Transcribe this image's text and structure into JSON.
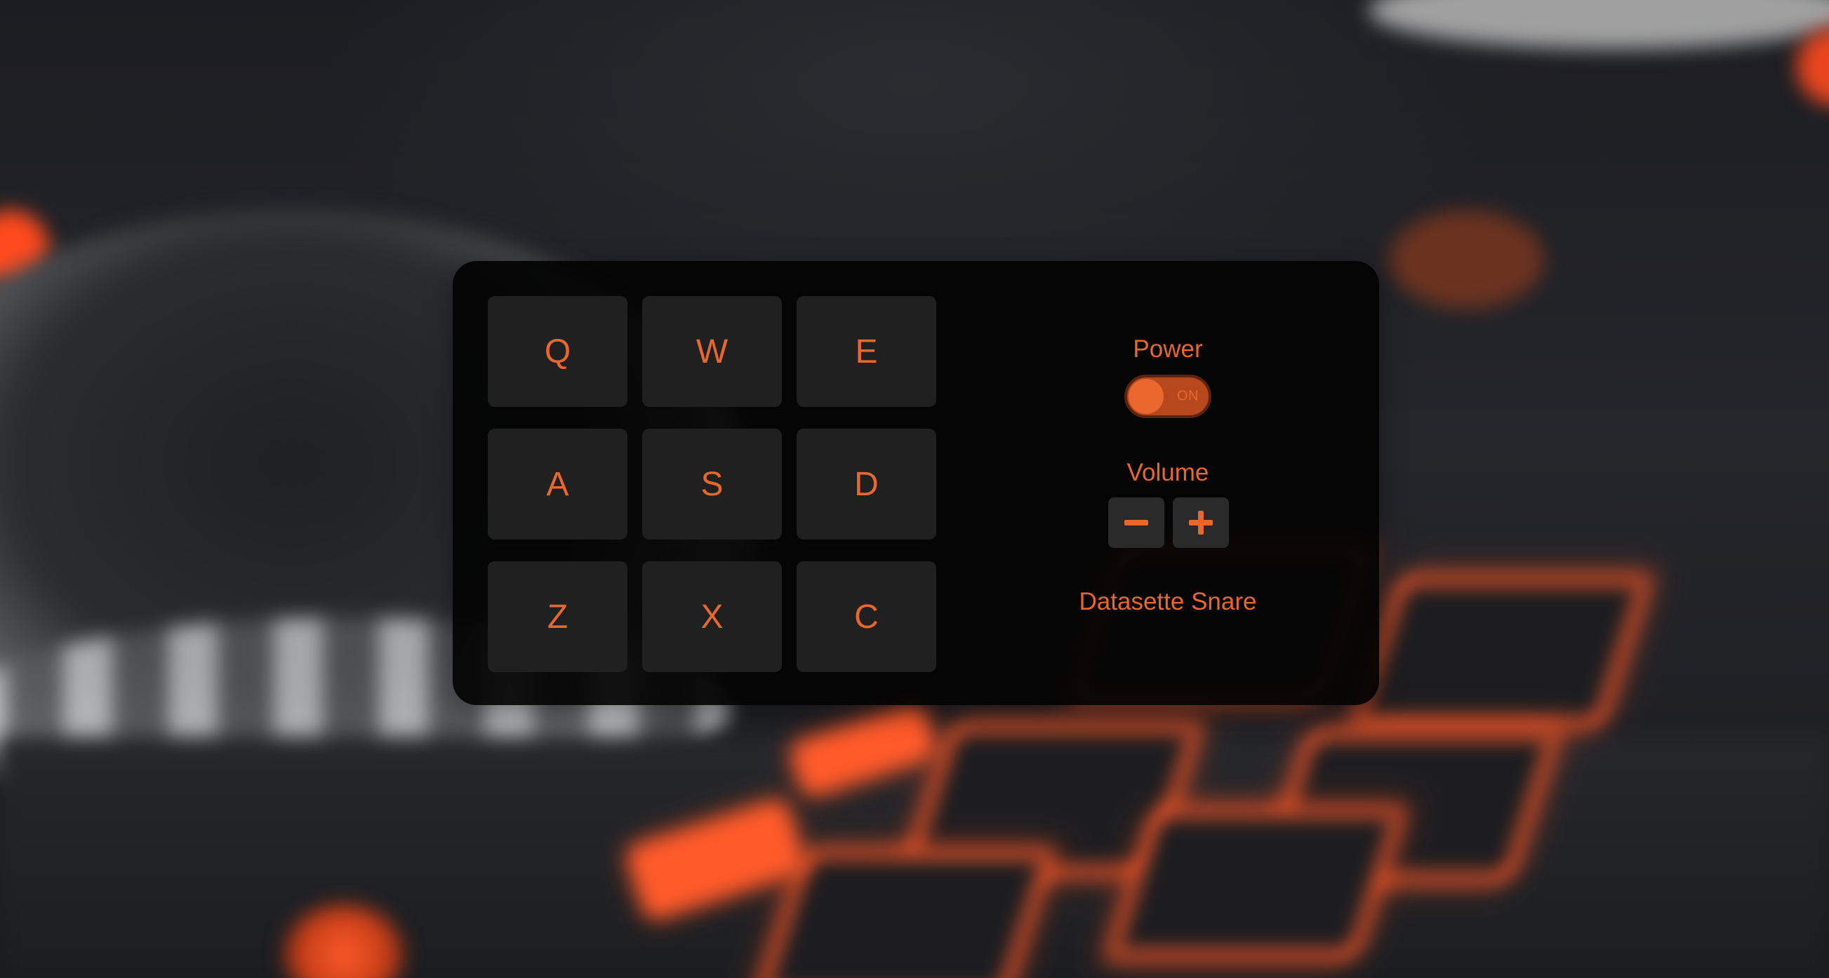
{
  "drum_machine": {
    "pads": [
      "Q",
      "W",
      "E",
      "A",
      "S",
      "D",
      "Z",
      "X",
      "C"
    ]
  },
  "controls": {
    "power": {
      "label": "Power",
      "state_text": "ON",
      "is_on": true
    },
    "volume": {
      "label": "Volume",
      "decrease_icon": "minus-icon",
      "increase_icon": "plus-icon"
    },
    "display": {
      "text": "Datasette Snare"
    }
  },
  "colors": {
    "accent": "#e8672e",
    "panel": "#030303",
    "pad": "#202020",
    "toggle_track": "#b7471d"
  }
}
